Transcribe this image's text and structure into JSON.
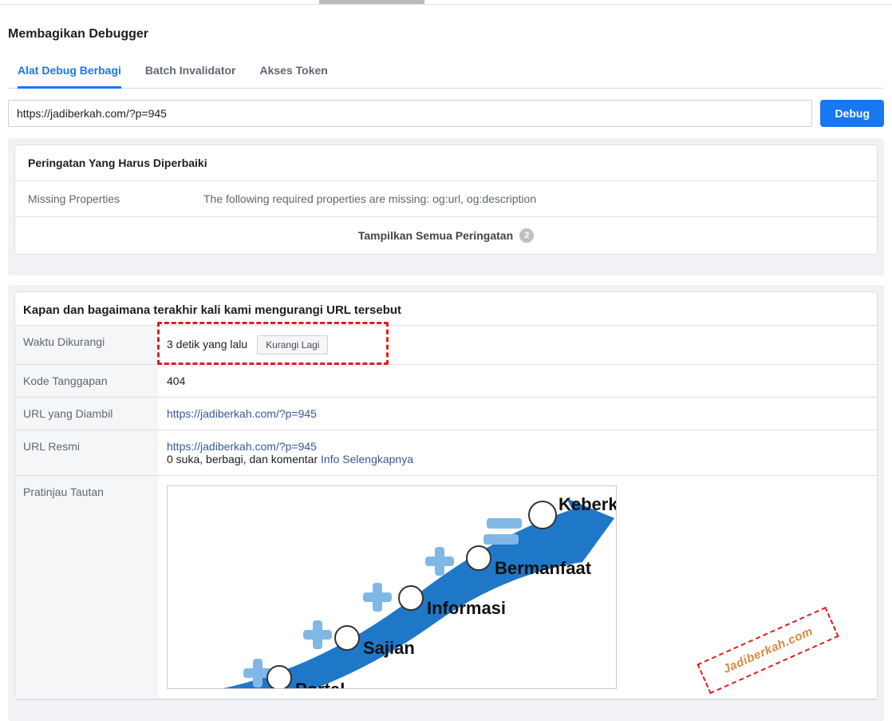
{
  "page_title": "Membagikan Debugger",
  "tabs": [
    {
      "label": "Alat Debug Berbagi",
      "active": true
    },
    {
      "label": "Batch Invalidator",
      "active": false
    },
    {
      "label": "Akses Token",
      "active": false
    }
  ],
  "debug_form": {
    "url_value": "https://jadiberkah.com/?p=945",
    "button_label": "Debug"
  },
  "warnings_panel": {
    "header": "Peringatan Yang Harus Diperbaiki",
    "items": [
      {
        "label": "Missing Properties",
        "message": "The following required properties are missing: og:url, og:description"
      }
    ],
    "show_all_label": "Tampilkan Semua Peringatan",
    "show_all_count": "2"
  },
  "scrape_panel": {
    "header": "Kapan dan bagaimana terakhir kali kami mengurangi URL tersebut",
    "rows": {
      "time_key": "Waktu Dikurangi",
      "time_val": "3 detik yang lalu",
      "rescrape_label": "Kurangi Lagi",
      "code_key": "Kode Tanggapan",
      "code_val": "404",
      "fetched_key": "URL yang Diambil",
      "fetched_val": "https://jadiberkah.com/?p=945",
      "canonical_key": "URL Resmi",
      "canonical_val": "https://jadiberkah.com/?p=945",
      "canonical_stats": "0 suka, berbagi, dan komentar ",
      "canonical_more": "Info Selengkapnya",
      "preview_key": "Pratinjau Tautan"
    }
  },
  "preview_image": {
    "labels": [
      "Portal",
      "Sajian",
      "Informasi",
      "Bermanfaat",
      "Keberkahan"
    ]
  },
  "watermark": "Jadiberkah.com"
}
